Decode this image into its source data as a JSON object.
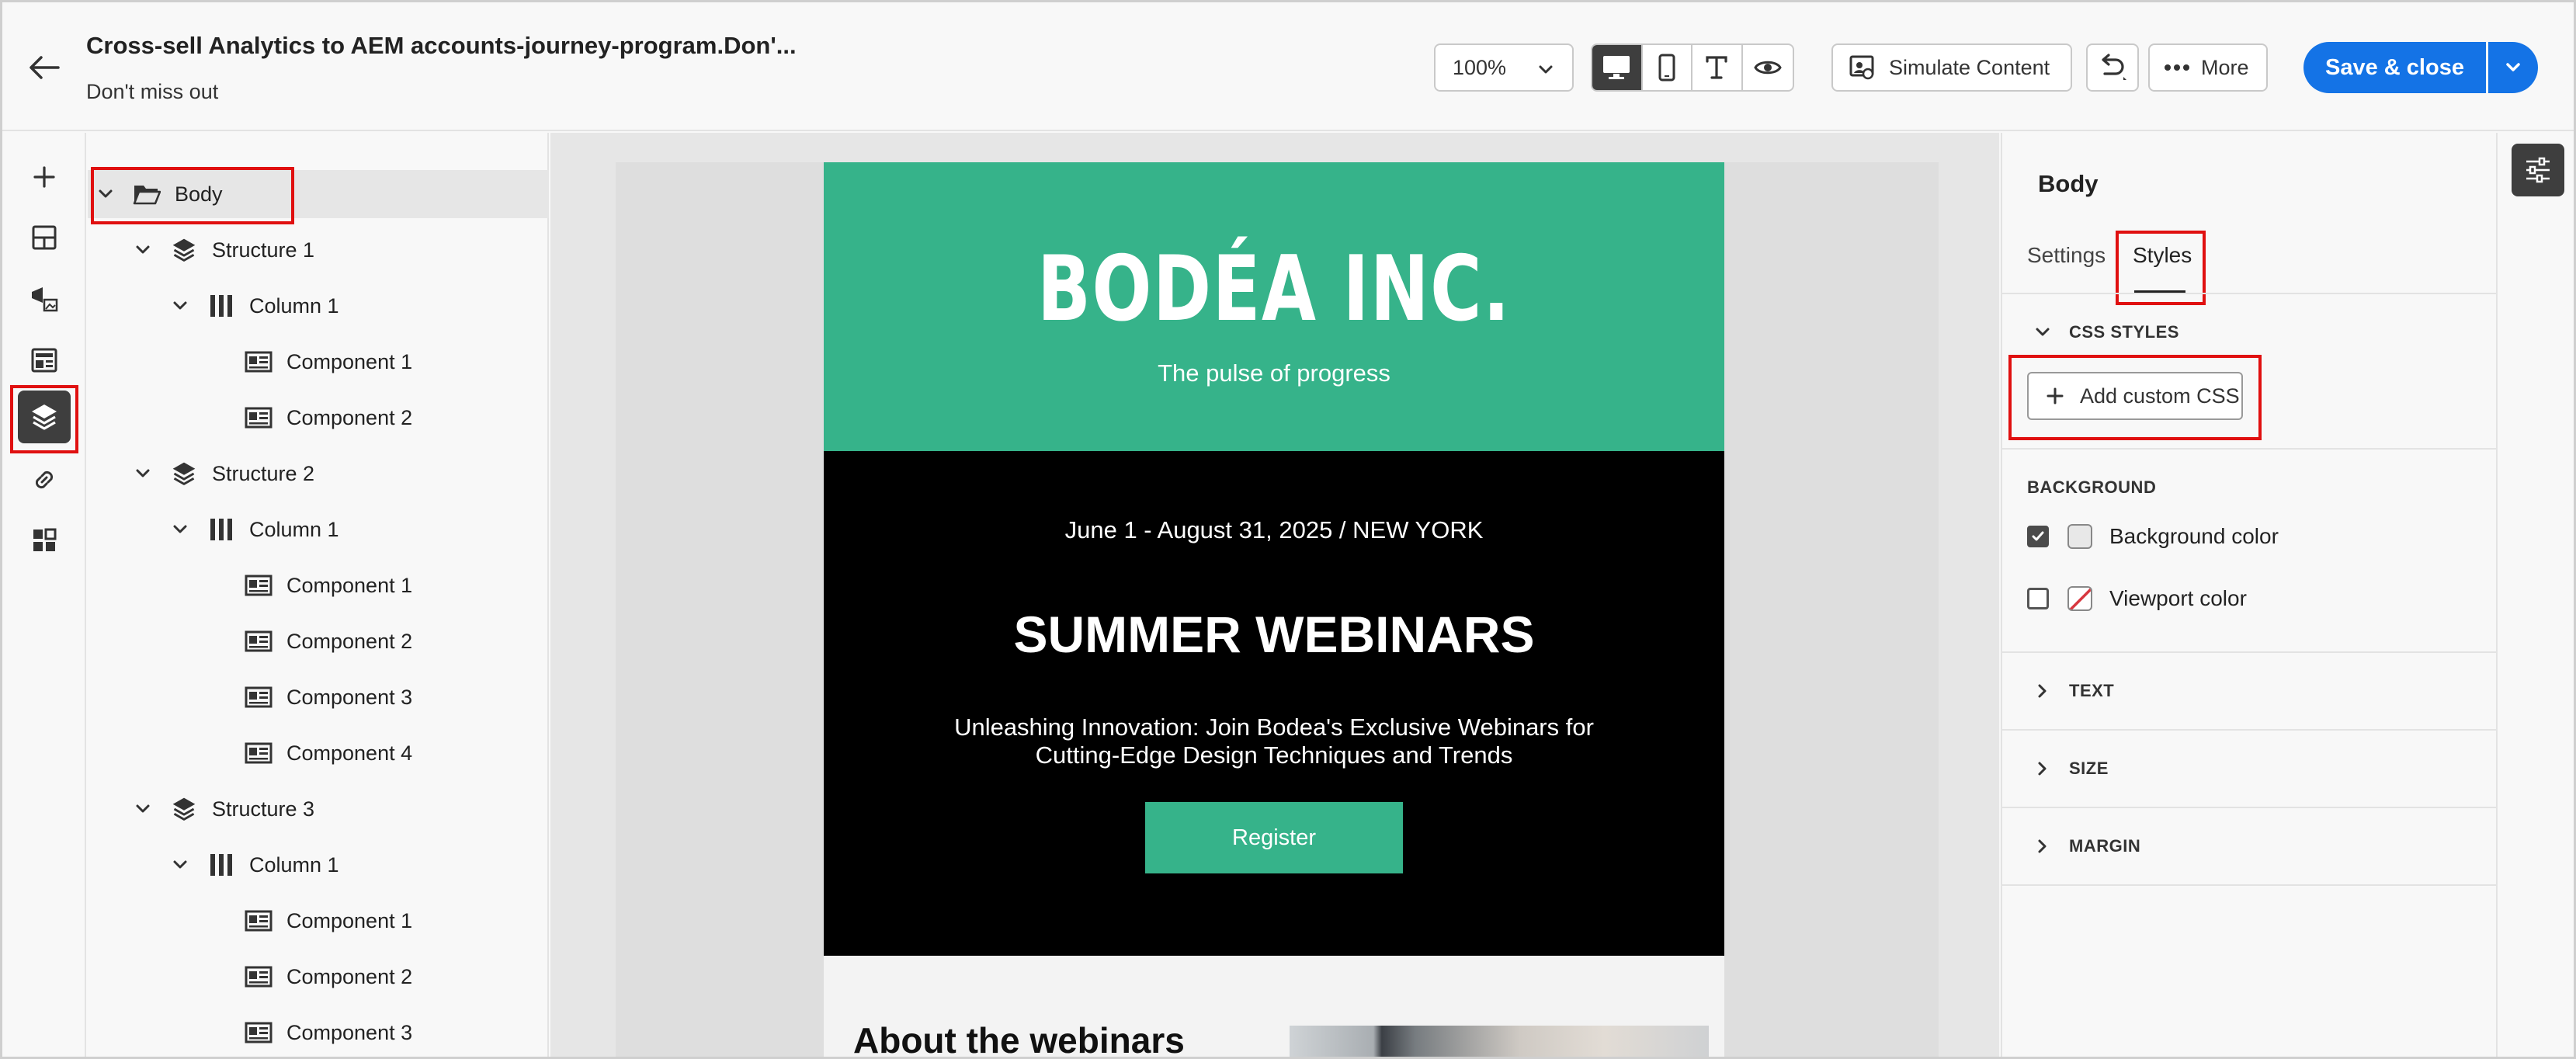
{
  "header": {
    "title": "Cross-sell Analytics to AEM accounts-journey-program.Don'...",
    "subtitle": "Don't miss out",
    "zoom": "100%",
    "simulate_label": "Simulate Content",
    "more_label": "More",
    "save_label": "Save & close"
  },
  "tree": {
    "body": "Body",
    "structure1": "Structure 1",
    "s1_column1": "Column 1",
    "s1_c1": "Component 1",
    "s1_c2": "Component 2",
    "structure2": "Structure 2",
    "s2_column1": "Column 1",
    "s2_c1": "Component 1",
    "s2_c2": "Component 2",
    "s2_c3": "Component 3",
    "s2_c4": "Component 4",
    "structure3": "Structure 3",
    "s3_column1": "Column 1",
    "s3_c1": "Component 1",
    "s3_c2": "Component 2",
    "s3_c3": "Component 3"
  },
  "email": {
    "logo": "BODÉA INC.",
    "tagline": "The pulse of progress",
    "dates": "June 1 - August 31, 2025 / NEW YORK",
    "headline": "SUMMER WEBINARS",
    "description": "Unleashing Innovation: Join Bodea's Exclusive Webinars for Cutting-Edge Design Techniques and Trends",
    "cta": "Register",
    "about": "About the webinars"
  },
  "panel": {
    "title": "Body",
    "tab_settings": "Settings",
    "tab_styles": "Styles",
    "css_styles": "CSS STYLES",
    "add_css": "Add custom CSS",
    "background": "BACKGROUND",
    "bg_color": "Background color",
    "viewport_color": "Viewport color",
    "text": "TEXT",
    "size": "SIZE",
    "margin": "MARGIN"
  },
  "colors": {
    "accent": "#1473e6",
    "brand_green": "#36b38a",
    "highlight": "#e01010"
  }
}
